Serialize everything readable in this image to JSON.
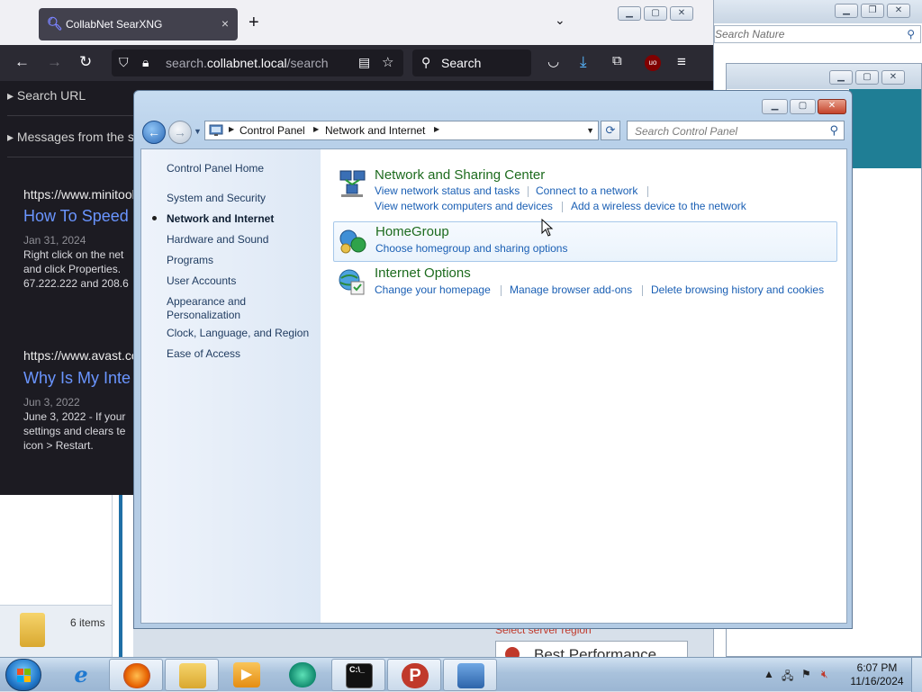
{
  "browser": {
    "tab_title": "CollabNet SearXNG",
    "tab_close": "×",
    "new_tab": "+",
    "list_tabs": "⌄",
    "url_host_prefix": "search.",
    "url_host_main": "collabnet.local",
    "url_path": "/search",
    "search_placeholder": "Search",
    "sections": [
      {
        "label": "Search URL"
      },
      {
        "label": "Messages from the s"
      }
    ],
    "results": [
      {
        "url": "https://www.minitool",
        "title": "How To Speed",
        "date": "Jan 31, 2024",
        "snippet": "Right click on the net\nand click Properties.\n67.222.222 and 208.6"
      },
      {
        "url": "https://www.avast.co",
        "title": "Why Is My Inte",
        "date": "Jun 3, 2022",
        "snippet": "June 3, 2022 - If your\nsettings and clears te\nicon > Restart."
      }
    ]
  },
  "background_window": {
    "search_placeholder": "Search Nature"
  },
  "explorer": {
    "items_count": "6 items"
  },
  "vpn_app": {
    "region_label": "Select server region",
    "region_value": "Best Performance"
  },
  "control_panel": {
    "breadcrumb": [
      "Control Panel",
      "Network and Internet"
    ],
    "search_placeholder": "Search Control Panel",
    "left_nav": {
      "home": "Control Panel Home",
      "items": [
        "System and Security",
        "Network and Internet",
        "Hardware and Sound",
        "Programs",
        "User Accounts",
        "Appearance and\nPersonalization",
        "Clock, Language, and Region",
        "Ease of Access"
      ],
      "current_index": 1
    },
    "categories": [
      {
        "title": "Network and Sharing Center",
        "links": [
          "View network status and tasks",
          "Connect to a network",
          "View network computers and devices",
          "Add a wireless device to the network"
        ]
      },
      {
        "title": "HomeGroup",
        "links": [
          "Choose homegroup and sharing options"
        ]
      },
      {
        "title": "Internet Options",
        "links": [
          "Change your homepage",
          "Manage browser add-ons",
          "Delete browsing history and cookies"
        ]
      }
    ]
  },
  "taskbar": {
    "clock_time": "6:07 PM",
    "clock_date": "11/16/2024",
    "pinned": [
      "internet-explorer",
      "firefox",
      "file-explorer",
      "media-center",
      "edge-like",
      "command-prompt",
      "psiphon",
      "control-panel"
    ]
  },
  "colors": {
    "cp_link": "#1a5fb4",
    "cp_category_title": "#1d6b1e",
    "browser_bg": "#1c1b22",
    "result_title": "#6a95ff"
  }
}
